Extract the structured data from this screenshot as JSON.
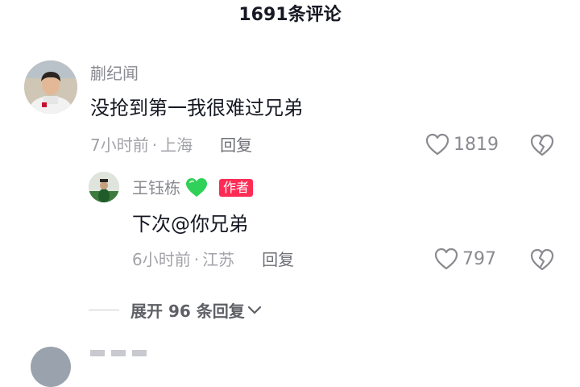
{
  "header": {
    "title": "1691条评论"
  },
  "comment": {
    "username": "蒯纪闻",
    "text": "没抢到第一我很难过兄弟",
    "time": "7小时前",
    "separator": "·",
    "location": "上海",
    "reply_label": "回复",
    "likes": "1819"
  },
  "reply": {
    "username": "王钰栋",
    "emoji": "green-heart",
    "badge": "作者",
    "text": "下次@你兄弟",
    "time": "6小时前",
    "separator": "·",
    "location": "江苏",
    "reply_label": "回复",
    "likes": "797"
  },
  "expand": {
    "label": "展开 96 条回复"
  },
  "colors": {
    "badge": "#fe2c55",
    "green_heart": "#2fd158",
    "secondary_text": "#8a8b91",
    "primary_text": "#161823"
  }
}
